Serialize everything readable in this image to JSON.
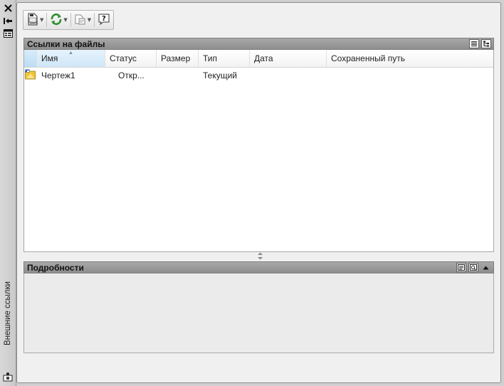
{
  "palette": {
    "title": "Внешние ссылки",
    "close_icon": "close-icon",
    "autohide_icon": "autohide-icon",
    "properties_icon": "properties-icon",
    "bottom_icon": "xref-manager-icon"
  },
  "toolbar": {
    "buttons": [
      {
        "icon": "attach-dwg-icon",
        "has_dropdown": true
      },
      {
        "icon": "refresh-icon",
        "has_dropdown": true
      },
      {
        "icon": "change-path-icon",
        "has_dropdown": true
      },
      {
        "icon": "help-icon",
        "has_dropdown": false
      }
    ]
  },
  "references": {
    "title": "Ссылки на файлы",
    "view_buttons": [
      "list-view-icon",
      "tree-view-icon"
    ],
    "columns": [
      "Имя",
      "Статус",
      "Размер",
      "Тип",
      "Дата",
      "Сохраненный путь"
    ],
    "sorted_column": "Имя",
    "rows": [
      {
        "icon": "drawing-icon",
        "name": "Чертеж1",
        "status": "Откр...",
        "size": "",
        "type": "Текущий",
        "date": "",
        "saved_path": ""
      }
    ]
  },
  "details": {
    "title": "Подробности",
    "buttons": [
      "details-icon",
      "preview-icon"
    ],
    "collapse_icon": "collapse-up-icon"
  },
  "colors": {
    "header_bar": "#979797",
    "panel_bg": "#f0f0f0",
    "selected_column": "#cfe6f7"
  }
}
